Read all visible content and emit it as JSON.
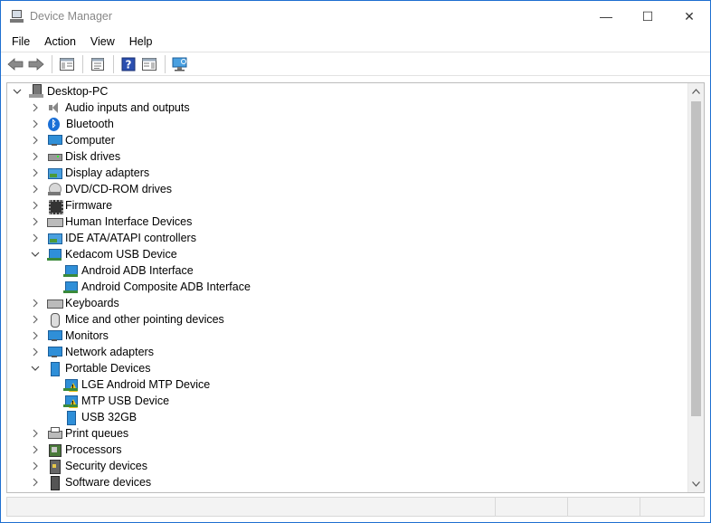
{
  "window": {
    "title": "Device Manager",
    "controls": {
      "minimize": "—",
      "maximize": "☐",
      "close": "✕"
    }
  },
  "menu": [
    "File",
    "Action",
    "View",
    "Help"
  ],
  "toolbar": [
    {
      "icon": "back-arrow-icon"
    },
    {
      "icon": "forward-arrow-icon"
    },
    {
      "icon": "show-hide-console-tree-icon"
    },
    {
      "icon": "properties-icon"
    },
    {
      "icon": "help-icon"
    },
    {
      "icon": "action-pane-icon"
    },
    {
      "icon": "scan-hardware-icon"
    }
  ],
  "tree": {
    "root": "Desktop-PC",
    "items": [
      {
        "label": "Audio inputs and outputs",
        "icon": "speaker-icon",
        "expanded": false
      },
      {
        "label": "Bluetooth",
        "icon": "bluetooth-icon",
        "expanded": false
      },
      {
        "label": "Computer",
        "icon": "computer-icon",
        "expanded": false
      },
      {
        "label": "Disk drives",
        "icon": "disk-drive-icon",
        "expanded": false
      },
      {
        "label": "Display adapters",
        "icon": "display-adapter-icon",
        "expanded": false
      },
      {
        "label": "DVD/CD-ROM drives",
        "icon": "dvd-drive-icon",
        "expanded": false
      },
      {
        "label": "Firmware",
        "icon": "firmware-icon",
        "expanded": false
      },
      {
        "label": "Human Interface Devices",
        "icon": "hid-icon",
        "expanded": false
      },
      {
        "label": "IDE ATA/ATAPI controllers",
        "icon": "ide-controller-icon",
        "expanded": false
      },
      {
        "label": "Kedacom USB Device",
        "icon": "usb-device-icon",
        "expanded": true,
        "children": [
          {
            "label": "Android ADB Interface",
            "icon": "usb-device-icon",
            "warning": false
          },
          {
            "label": "Android Composite ADB Interface",
            "icon": "usb-device-icon",
            "warning": false
          }
        ]
      },
      {
        "label": "Keyboards",
        "icon": "keyboard-icon",
        "expanded": false
      },
      {
        "label": "Mice and other pointing devices",
        "icon": "mouse-icon",
        "expanded": false
      },
      {
        "label": "Monitors",
        "icon": "monitor-icon",
        "expanded": false
      },
      {
        "label": "Network adapters",
        "icon": "network-adapter-icon",
        "expanded": false
      },
      {
        "label": "Portable Devices",
        "icon": "portable-device-icon",
        "expanded": true,
        "children": [
          {
            "label": "LGE Android MTP Device",
            "icon": "warning-device-icon",
            "warning": true
          },
          {
            "label": "MTP USB Device",
            "icon": "warning-device-icon",
            "warning": true
          },
          {
            "label": "USB 32GB",
            "icon": "portable-device-icon",
            "warning": false
          }
        ]
      },
      {
        "label": "Print queues",
        "icon": "printer-icon",
        "expanded": false
      },
      {
        "label": "Processors",
        "icon": "processor-icon",
        "expanded": false
      },
      {
        "label": "Security devices",
        "icon": "security-device-icon",
        "expanded": false
      },
      {
        "label": "Software devices",
        "icon": "software-device-icon",
        "expanded": false
      }
    ]
  },
  "colors": {
    "accent": "#1e73c8",
    "warning": "#f0c419"
  }
}
